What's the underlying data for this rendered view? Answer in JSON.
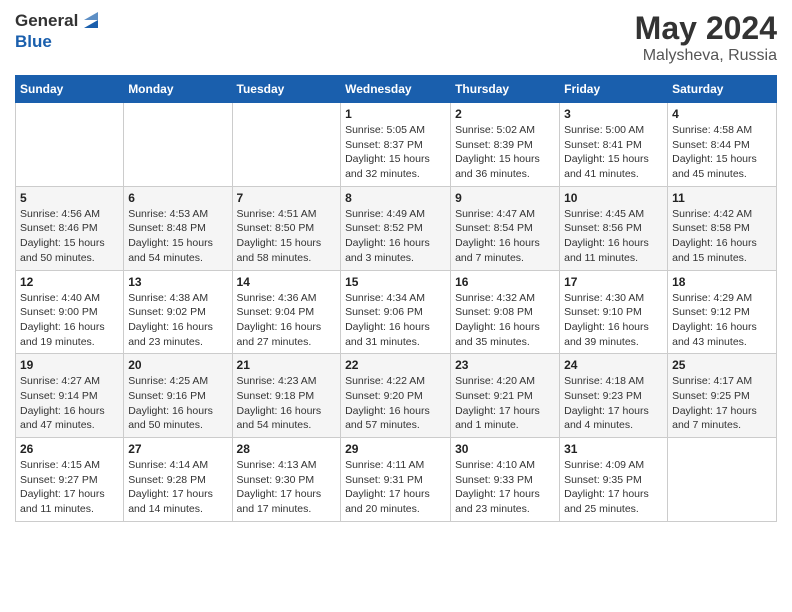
{
  "header": {
    "logo_line1": "General",
    "logo_line2": "Blue",
    "month_year": "May 2024",
    "location": "Malysheva, Russia"
  },
  "days_of_week": [
    "Sunday",
    "Monday",
    "Tuesday",
    "Wednesday",
    "Thursday",
    "Friday",
    "Saturday"
  ],
  "weeks": [
    [
      {
        "day": "",
        "info": ""
      },
      {
        "day": "",
        "info": ""
      },
      {
        "day": "",
        "info": ""
      },
      {
        "day": "1",
        "info": "Sunrise: 5:05 AM\nSunset: 8:37 PM\nDaylight: 15 hours\nand 32 minutes."
      },
      {
        "day": "2",
        "info": "Sunrise: 5:02 AM\nSunset: 8:39 PM\nDaylight: 15 hours\nand 36 minutes."
      },
      {
        "day": "3",
        "info": "Sunrise: 5:00 AM\nSunset: 8:41 PM\nDaylight: 15 hours\nand 41 minutes."
      },
      {
        "day": "4",
        "info": "Sunrise: 4:58 AM\nSunset: 8:44 PM\nDaylight: 15 hours\nand 45 minutes."
      }
    ],
    [
      {
        "day": "5",
        "info": "Sunrise: 4:56 AM\nSunset: 8:46 PM\nDaylight: 15 hours\nand 50 minutes."
      },
      {
        "day": "6",
        "info": "Sunrise: 4:53 AM\nSunset: 8:48 PM\nDaylight: 15 hours\nand 54 minutes."
      },
      {
        "day": "7",
        "info": "Sunrise: 4:51 AM\nSunset: 8:50 PM\nDaylight: 15 hours\nand 58 minutes."
      },
      {
        "day": "8",
        "info": "Sunrise: 4:49 AM\nSunset: 8:52 PM\nDaylight: 16 hours\nand 3 minutes."
      },
      {
        "day": "9",
        "info": "Sunrise: 4:47 AM\nSunset: 8:54 PM\nDaylight: 16 hours\nand 7 minutes."
      },
      {
        "day": "10",
        "info": "Sunrise: 4:45 AM\nSunset: 8:56 PM\nDaylight: 16 hours\nand 11 minutes."
      },
      {
        "day": "11",
        "info": "Sunrise: 4:42 AM\nSunset: 8:58 PM\nDaylight: 16 hours\nand 15 minutes."
      }
    ],
    [
      {
        "day": "12",
        "info": "Sunrise: 4:40 AM\nSunset: 9:00 PM\nDaylight: 16 hours\nand 19 minutes."
      },
      {
        "day": "13",
        "info": "Sunrise: 4:38 AM\nSunset: 9:02 PM\nDaylight: 16 hours\nand 23 minutes."
      },
      {
        "day": "14",
        "info": "Sunrise: 4:36 AM\nSunset: 9:04 PM\nDaylight: 16 hours\nand 27 minutes."
      },
      {
        "day": "15",
        "info": "Sunrise: 4:34 AM\nSunset: 9:06 PM\nDaylight: 16 hours\nand 31 minutes."
      },
      {
        "day": "16",
        "info": "Sunrise: 4:32 AM\nSunset: 9:08 PM\nDaylight: 16 hours\nand 35 minutes."
      },
      {
        "day": "17",
        "info": "Sunrise: 4:30 AM\nSunset: 9:10 PM\nDaylight: 16 hours\nand 39 minutes."
      },
      {
        "day": "18",
        "info": "Sunrise: 4:29 AM\nSunset: 9:12 PM\nDaylight: 16 hours\nand 43 minutes."
      }
    ],
    [
      {
        "day": "19",
        "info": "Sunrise: 4:27 AM\nSunset: 9:14 PM\nDaylight: 16 hours\nand 47 minutes."
      },
      {
        "day": "20",
        "info": "Sunrise: 4:25 AM\nSunset: 9:16 PM\nDaylight: 16 hours\nand 50 minutes."
      },
      {
        "day": "21",
        "info": "Sunrise: 4:23 AM\nSunset: 9:18 PM\nDaylight: 16 hours\nand 54 minutes."
      },
      {
        "day": "22",
        "info": "Sunrise: 4:22 AM\nSunset: 9:20 PM\nDaylight: 16 hours\nand 57 minutes."
      },
      {
        "day": "23",
        "info": "Sunrise: 4:20 AM\nSunset: 9:21 PM\nDaylight: 17 hours\nand 1 minute."
      },
      {
        "day": "24",
        "info": "Sunrise: 4:18 AM\nSunset: 9:23 PM\nDaylight: 17 hours\nand 4 minutes."
      },
      {
        "day": "25",
        "info": "Sunrise: 4:17 AM\nSunset: 9:25 PM\nDaylight: 17 hours\nand 7 minutes."
      }
    ],
    [
      {
        "day": "26",
        "info": "Sunrise: 4:15 AM\nSunset: 9:27 PM\nDaylight: 17 hours\nand 11 minutes."
      },
      {
        "day": "27",
        "info": "Sunrise: 4:14 AM\nSunset: 9:28 PM\nDaylight: 17 hours\nand 14 minutes."
      },
      {
        "day": "28",
        "info": "Sunrise: 4:13 AM\nSunset: 9:30 PM\nDaylight: 17 hours\nand 17 minutes."
      },
      {
        "day": "29",
        "info": "Sunrise: 4:11 AM\nSunset: 9:31 PM\nDaylight: 17 hours\nand 20 minutes."
      },
      {
        "day": "30",
        "info": "Sunrise: 4:10 AM\nSunset: 9:33 PM\nDaylight: 17 hours\nand 23 minutes."
      },
      {
        "day": "31",
        "info": "Sunrise: 4:09 AM\nSunset: 9:35 PM\nDaylight: 17 hours\nand 25 minutes."
      },
      {
        "day": "",
        "info": ""
      }
    ]
  ]
}
